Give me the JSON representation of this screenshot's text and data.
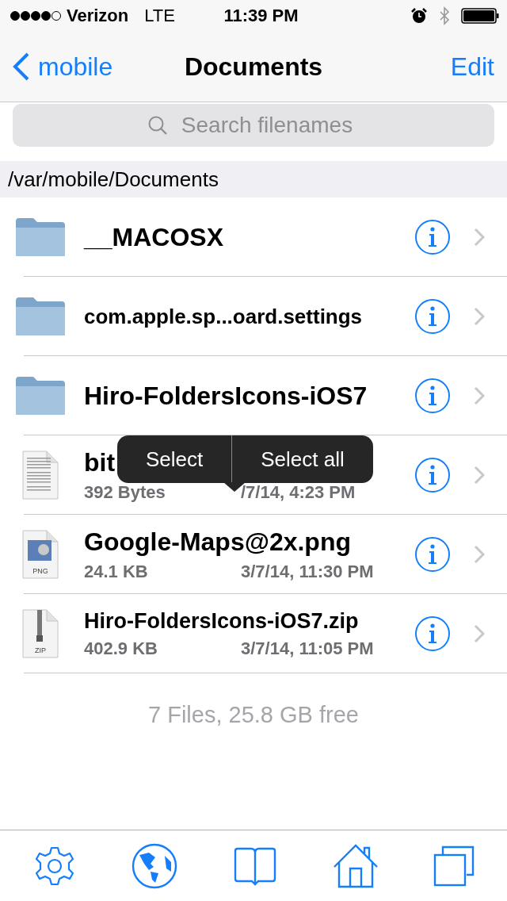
{
  "status_bar": {
    "carrier": "Verizon",
    "network": "LTE",
    "time": "11:39 PM"
  },
  "nav": {
    "back": "mobile",
    "title": "Documents",
    "action": "Edit"
  },
  "search": {
    "placeholder": "Search filenames"
  },
  "path": "/var/mobile/Documents",
  "files": [
    {
      "kind": "folder",
      "name": "__MACOSX"
    },
    {
      "kind": "folder",
      "name": "com.apple.sp...oard.settings"
    },
    {
      "kind": "folder",
      "name": "Hiro-FoldersIcons-iOS7"
    },
    {
      "kind": "text",
      "name": "bit",
      "size": "392 Bytes",
      "date": "/7/14, 4:23 PM",
      "menu_actions": [
        "Select",
        "Select all"
      ]
    },
    {
      "kind": "image",
      "name": "Google-Maps@2x.png",
      "size": "24.1 KB",
      "date": "3/7/14, 11:30 PM",
      "badge": "PNG"
    },
    {
      "kind": "archive",
      "name": "Hiro-FoldersIcons-iOS7.zip",
      "size": "402.9 KB",
      "date": "3/7/14, 11:05 PM",
      "badge": "ZIP"
    }
  ],
  "footer": "7 Files, 25.8 GB free"
}
